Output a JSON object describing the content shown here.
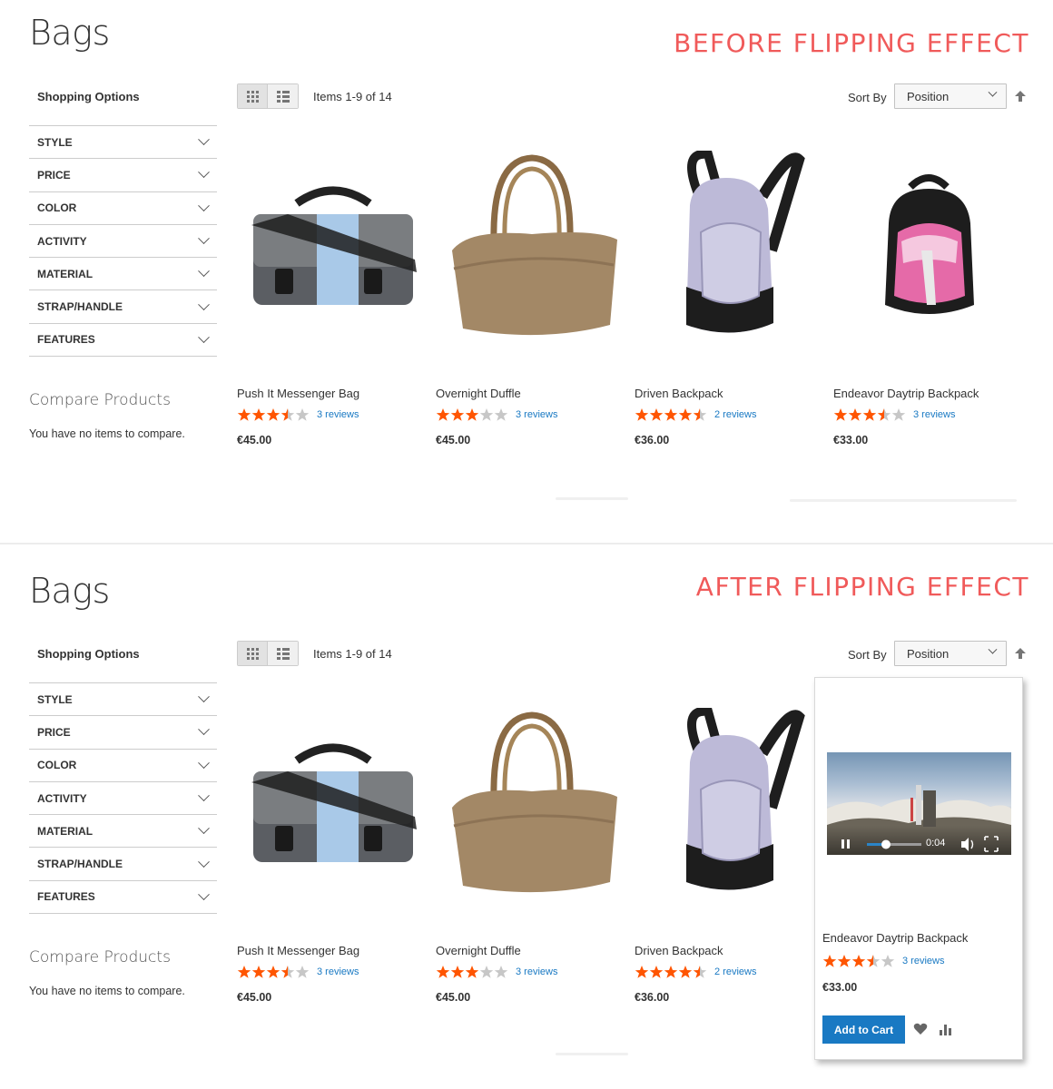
{
  "top": {
    "page_title": "Bags",
    "effect_label": "BEFORE FLIPPING EFFECT"
  },
  "bottom": {
    "page_title": "Bags",
    "effect_label": "AFTER FLIPPING EFFECT"
  },
  "sidebar": {
    "title": "Shopping Options",
    "filters": [
      "STYLE",
      "PRICE",
      "COLOR",
      "ACTIVITY",
      "MATERIAL",
      "STRAP/HANDLE",
      "FEATURES"
    ],
    "compare_title": "Compare Products",
    "compare_empty": "You have no items to compare."
  },
  "toolbar": {
    "grid_icon": "grid-view-icon",
    "list_icon": "list-view-icon",
    "amount": "Items 1-9 of 14",
    "sort_label": "Sort By",
    "sort_value": "Position",
    "sort_direction_icon": "arrow-up-icon"
  },
  "products": [
    {
      "name": "Push It Messenger Bag",
      "rating": 3.5,
      "reviews": "3 reviews",
      "price": "€45.00"
    },
    {
      "name": "Overnight Duffle",
      "rating": 3,
      "reviews": "3 reviews",
      "price": "€45.00"
    },
    {
      "name": "Driven Backpack",
      "rating": 4.5,
      "reviews": "2 reviews",
      "price": "€36.00"
    },
    {
      "name": "Endeavor Daytrip Backpack",
      "rating": 3.5,
      "reviews": "3 reviews",
      "price": "€33.00"
    }
  ],
  "hover_card": {
    "video_time": "0:04",
    "video_progress": 0.35,
    "add_to_cart": "Add to Cart",
    "wishlist_icon": "heart-icon",
    "compare_icon": "compare-bars-icon"
  },
  "colors": {
    "accent_red": "#f05a5a",
    "star": "#ff5501",
    "star_empty": "#c7c7c7",
    "link": "#1979c3",
    "button": "#1979c3"
  }
}
